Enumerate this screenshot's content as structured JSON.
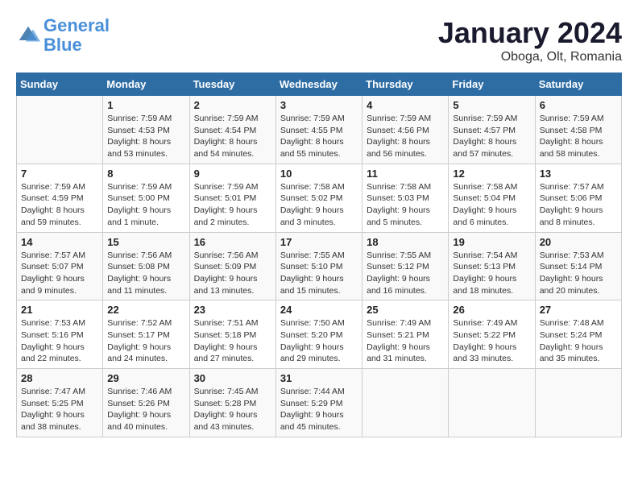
{
  "header": {
    "logo_line1": "General",
    "logo_line2": "Blue",
    "title": "January 2024",
    "subtitle": "Oboga, Olt, Romania"
  },
  "columns": [
    "Sunday",
    "Monday",
    "Tuesday",
    "Wednesday",
    "Thursday",
    "Friday",
    "Saturday"
  ],
  "weeks": [
    [
      {
        "day": "",
        "sunrise": "",
        "sunset": "",
        "daylight": ""
      },
      {
        "day": "1",
        "sunrise": "Sunrise: 7:59 AM",
        "sunset": "Sunset: 4:53 PM",
        "daylight": "Daylight: 8 hours and 53 minutes."
      },
      {
        "day": "2",
        "sunrise": "Sunrise: 7:59 AM",
        "sunset": "Sunset: 4:54 PM",
        "daylight": "Daylight: 8 hours and 54 minutes."
      },
      {
        "day": "3",
        "sunrise": "Sunrise: 7:59 AM",
        "sunset": "Sunset: 4:55 PM",
        "daylight": "Daylight: 8 hours and 55 minutes."
      },
      {
        "day": "4",
        "sunrise": "Sunrise: 7:59 AM",
        "sunset": "Sunset: 4:56 PM",
        "daylight": "Daylight: 8 hours and 56 minutes."
      },
      {
        "day": "5",
        "sunrise": "Sunrise: 7:59 AM",
        "sunset": "Sunset: 4:57 PM",
        "daylight": "Daylight: 8 hours and 57 minutes."
      },
      {
        "day": "6",
        "sunrise": "Sunrise: 7:59 AM",
        "sunset": "Sunset: 4:58 PM",
        "daylight": "Daylight: 8 hours and 58 minutes."
      }
    ],
    [
      {
        "day": "7",
        "sunrise": "Sunrise: 7:59 AM",
        "sunset": "Sunset: 4:59 PM",
        "daylight": "Daylight: 8 hours and 59 minutes."
      },
      {
        "day": "8",
        "sunrise": "Sunrise: 7:59 AM",
        "sunset": "Sunset: 5:00 PM",
        "daylight": "Daylight: 9 hours and 1 minute."
      },
      {
        "day": "9",
        "sunrise": "Sunrise: 7:59 AM",
        "sunset": "Sunset: 5:01 PM",
        "daylight": "Daylight: 9 hours and 2 minutes."
      },
      {
        "day": "10",
        "sunrise": "Sunrise: 7:58 AM",
        "sunset": "Sunset: 5:02 PM",
        "daylight": "Daylight: 9 hours and 3 minutes."
      },
      {
        "day": "11",
        "sunrise": "Sunrise: 7:58 AM",
        "sunset": "Sunset: 5:03 PM",
        "daylight": "Daylight: 9 hours and 5 minutes."
      },
      {
        "day": "12",
        "sunrise": "Sunrise: 7:58 AM",
        "sunset": "Sunset: 5:04 PM",
        "daylight": "Daylight: 9 hours and 6 minutes."
      },
      {
        "day": "13",
        "sunrise": "Sunrise: 7:57 AM",
        "sunset": "Sunset: 5:06 PM",
        "daylight": "Daylight: 9 hours and 8 minutes."
      }
    ],
    [
      {
        "day": "14",
        "sunrise": "Sunrise: 7:57 AM",
        "sunset": "Sunset: 5:07 PM",
        "daylight": "Daylight: 9 hours and 9 minutes."
      },
      {
        "day": "15",
        "sunrise": "Sunrise: 7:56 AM",
        "sunset": "Sunset: 5:08 PM",
        "daylight": "Daylight: 9 hours and 11 minutes."
      },
      {
        "day": "16",
        "sunrise": "Sunrise: 7:56 AM",
        "sunset": "Sunset: 5:09 PM",
        "daylight": "Daylight: 9 hours and 13 minutes."
      },
      {
        "day": "17",
        "sunrise": "Sunrise: 7:55 AM",
        "sunset": "Sunset: 5:10 PM",
        "daylight": "Daylight: 9 hours and 15 minutes."
      },
      {
        "day": "18",
        "sunrise": "Sunrise: 7:55 AM",
        "sunset": "Sunset: 5:12 PM",
        "daylight": "Daylight: 9 hours and 16 minutes."
      },
      {
        "day": "19",
        "sunrise": "Sunrise: 7:54 AM",
        "sunset": "Sunset: 5:13 PM",
        "daylight": "Daylight: 9 hours and 18 minutes."
      },
      {
        "day": "20",
        "sunrise": "Sunrise: 7:53 AM",
        "sunset": "Sunset: 5:14 PM",
        "daylight": "Daylight: 9 hours and 20 minutes."
      }
    ],
    [
      {
        "day": "21",
        "sunrise": "Sunrise: 7:53 AM",
        "sunset": "Sunset: 5:16 PM",
        "daylight": "Daylight: 9 hours and 22 minutes."
      },
      {
        "day": "22",
        "sunrise": "Sunrise: 7:52 AM",
        "sunset": "Sunset: 5:17 PM",
        "daylight": "Daylight: 9 hours and 24 minutes."
      },
      {
        "day": "23",
        "sunrise": "Sunrise: 7:51 AM",
        "sunset": "Sunset: 5:18 PM",
        "daylight": "Daylight: 9 hours and 27 minutes."
      },
      {
        "day": "24",
        "sunrise": "Sunrise: 7:50 AM",
        "sunset": "Sunset: 5:20 PM",
        "daylight": "Daylight: 9 hours and 29 minutes."
      },
      {
        "day": "25",
        "sunrise": "Sunrise: 7:49 AM",
        "sunset": "Sunset: 5:21 PM",
        "daylight": "Daylight: 9 hours and 31 minutes."
      },
      {
        "day": "26",
        "sunrise": "Sunrise: 7:49 AM",
        "sunset": "Sunset: 5:22 PM",
        "daylight": "Daylight: 9 hours and 33 minutes."
      },
      {
        "day": "27",
        "sunrise": "Sunrise: 7:48 AM",
        "sunset": "Sunset: 5:24 PM",
        "daylight": "Daylight: 9 hours and 35 minutes."
      }
    ],
    [
      {
        "day": "28",
        "sunrise": "Sunrise: 7:47 AM",
        "sunset": "Sunset: 5:25 PM",
        "daylight": "Daylight: 9 hours and 38 minutes."
      },
      {
        "day": "29",
        "sunrise": "Sunrise: 7:46 AM",
        "sunset": "Sunset: 5:26 PM",
        "daylight": "Daylight: 9 hours and 40 minutes."
      },
      {
        "day": "30",
        "sunrise": "Sunrise: 7:45 AM",
        "sunset": "Sunset: 5:28 PM",
        "daylight": "Daylight: 9 hours and 43 minutes."
      },
      {
        "day": "31",
        "sunrise": "Sunrise: 7:44 AM",
        "sunset": "Sunset: 5:29 PM",
        "daylight": "Daylight: 9 hours and 45 minutes."
      },
      {
        "day": "",
        "sunrise": "",
        "sunset": "",
        "daylight": ""
      },
      {
        "day": "",
        "sunrise": "",
        "sunset": "",
        "daylight": ""
      },
      {
        "day": "",
        "sunrise": "",
        "sunset": "",
        "daylight": ""
      }
    ]
  ]
}
